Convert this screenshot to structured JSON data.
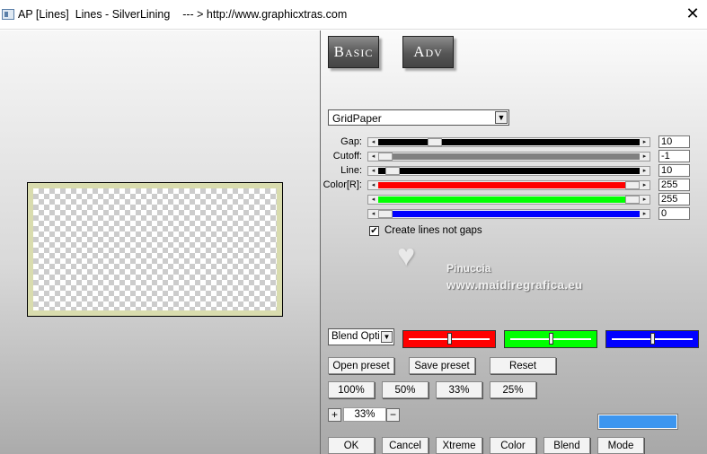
{
  "window": {
    "title": "AP [Lines]  Lines - SilverLining    --- > http://www.graphicxtras.com",
    "close_glyph": "✕"
  },
  "mode_buttons": {
    "basic": "Basic",
    "adv": "Adv"
  },
  "pattern_select": {
    "value": "GridPaper",
    "arrow": "▼"
  },
  "sliders": [
    {
      "label": "Gap:",
      "value": "10",
      "fill": "#000000",
      "pos": 0.2
    },
    {
      "label": "Cutoff:",
      "value": "-1",
      "fill": "#808080",
      "pos": 0.0
    },
    {
      "label": "Line:",
      "value": "10",
      "fill": "#000000",
      "pos": 0.03
    },
    {
      "label": "Color[R]:",
      "value": "255",
      "fill": "#ff0000",
      "pos": 1.0
    },
    {
      "label": "",
      "value": "255",
      "fill": "#00ff00",
      "pos": 1.0
    },
    {
      "label": "",
      "value": "0",
      "fill": "#0000ff",
      "pos": 0.0
    }
  ],
  "checkbox": {
    "label": "Create lines not gaps",
    "checked": true,
    "glyph": "✔"
  },
  "watermark": {
    "name": "Pinuccia",
    "url": "www.maidiregrafica.eu",
    "heart": "♥"
  },
  "blend_select": {
    "value": "Blend Optio",
    "arrow": "▼"
  },
  "color_bars": [
    {
      "color": "#ff0000",
      "pos": 0.5
    },
    {
      "color": "#00ff00",
      "pos": 0.5
    },
    {
      "color": "#0000ff",
      "pos": 0.5
    }
  ],
  "preset_buttons": {
    "open": "Open preset",
    "save": "Save preset",
    "reset": "Reset"
  },
  "zoom_buttons": [
    "100%",
    "50%",
    "33%",
    "25%"
  ],
  "zoom": {
    "plus": "+",
    "minus": "−",
    "value": "33%"
  },
  "swatch_color": "#3c96f0",
  "bottom_buttons": [
    "OK",
    "Cancel",
    "Xtreme",
    "Color",
    "Blend",
    "Mode"
  ],
  "arrows": {
    "left": "◂",
    "right": "▸"
  }
}
